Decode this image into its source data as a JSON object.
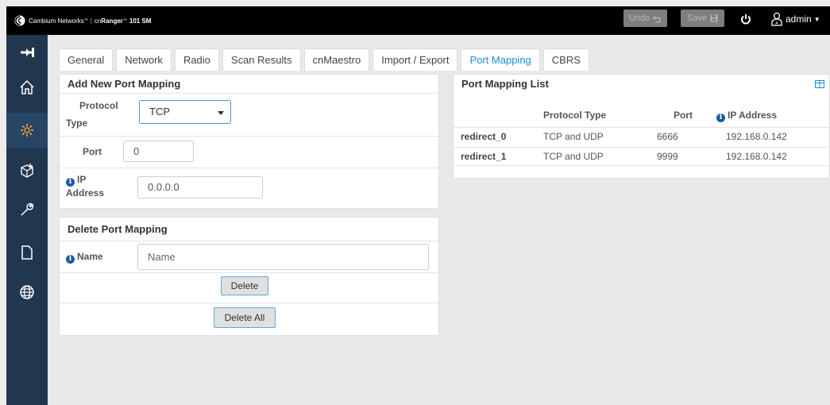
{
  "header": {
    "brand": "Cambium Networks",
    "tm": "™",
    "separator": "|",
    "product_prefix": "cn",
    "product": "Ranger",
    "product_tm": "™",
    "model": "101 SM",
    "undo_label": "Undo",
    "save_label": "Save",
    "user_label": "admin"
  },
  "sidebar": {
    "items": [
      {
        "icon": "collapse-icon"
      },
      {
        "icon": "home-icon"
      },
      {
        "icon": "settings-gear-icon",
        "active": true
      },
      {
        "icon": "network-add-icon"
      },
      {
        "icon": "wrench-icon"
      },
      {
        "icon": "document-icon"
      },
      {
        "icon": "globe-icon"
      }
    ]
  },
  "tabs": [
    {
      "label": "General"
    },
    {
      "label": "Network"
    },
    {
      "label": "Radio"
    },
    {
      "label": "Scan Results"
    },
    {
      "label": "cnMaestro"
    },
    {
      "label": "Import / Export"
    },
    {
      "label": "Port Mapping",
      "active": true
    },
    {
      "label": "CBRS"
    }
  ],
  "add_panel": {
    "title": "Add New Port Mapping",
    "protocol_label_1": "Protocol",
    "protocol_label_2": "Type",
    "protocol_value": "TCP",
    "port_label": "Port",
    "port_value": "0",
    "ip_label_1": "IP",
    "ip_label_2": "Address",
    "ip_value": "0.0.0.0"
  },
  "delete_panel": {
    "title": "Delete Port Mapping",
    "name_label": "Name",
    "name_placeholder": "Name",
    "delete_label": "Delete",
    "delete_all_label": "Delete All"
  },
  "list_panel": {
    "title": "Port Mapping List",
    "columns": [
      "Protocol Type",
      "Port",
      "IP Address"
    ],
    "rows": [
      {
        "name": "redirect_0",
        "protocol": "TCP and UDP",
        "port": "6666",
        "ip": "192.168.0.142"
      },
      {
        "name": "redirect_1",
        "protocol": "TCP and UDP",
        "port": "9999",
        "ip": "192.168.0.142"
      }
    ]
  },
  "colors": {
    "topbar": "#000000",
    "sidebar": "#21374f",
    "accent": "#1a8cd8",
    "info_icon": "#1a5da6"
  }
}
